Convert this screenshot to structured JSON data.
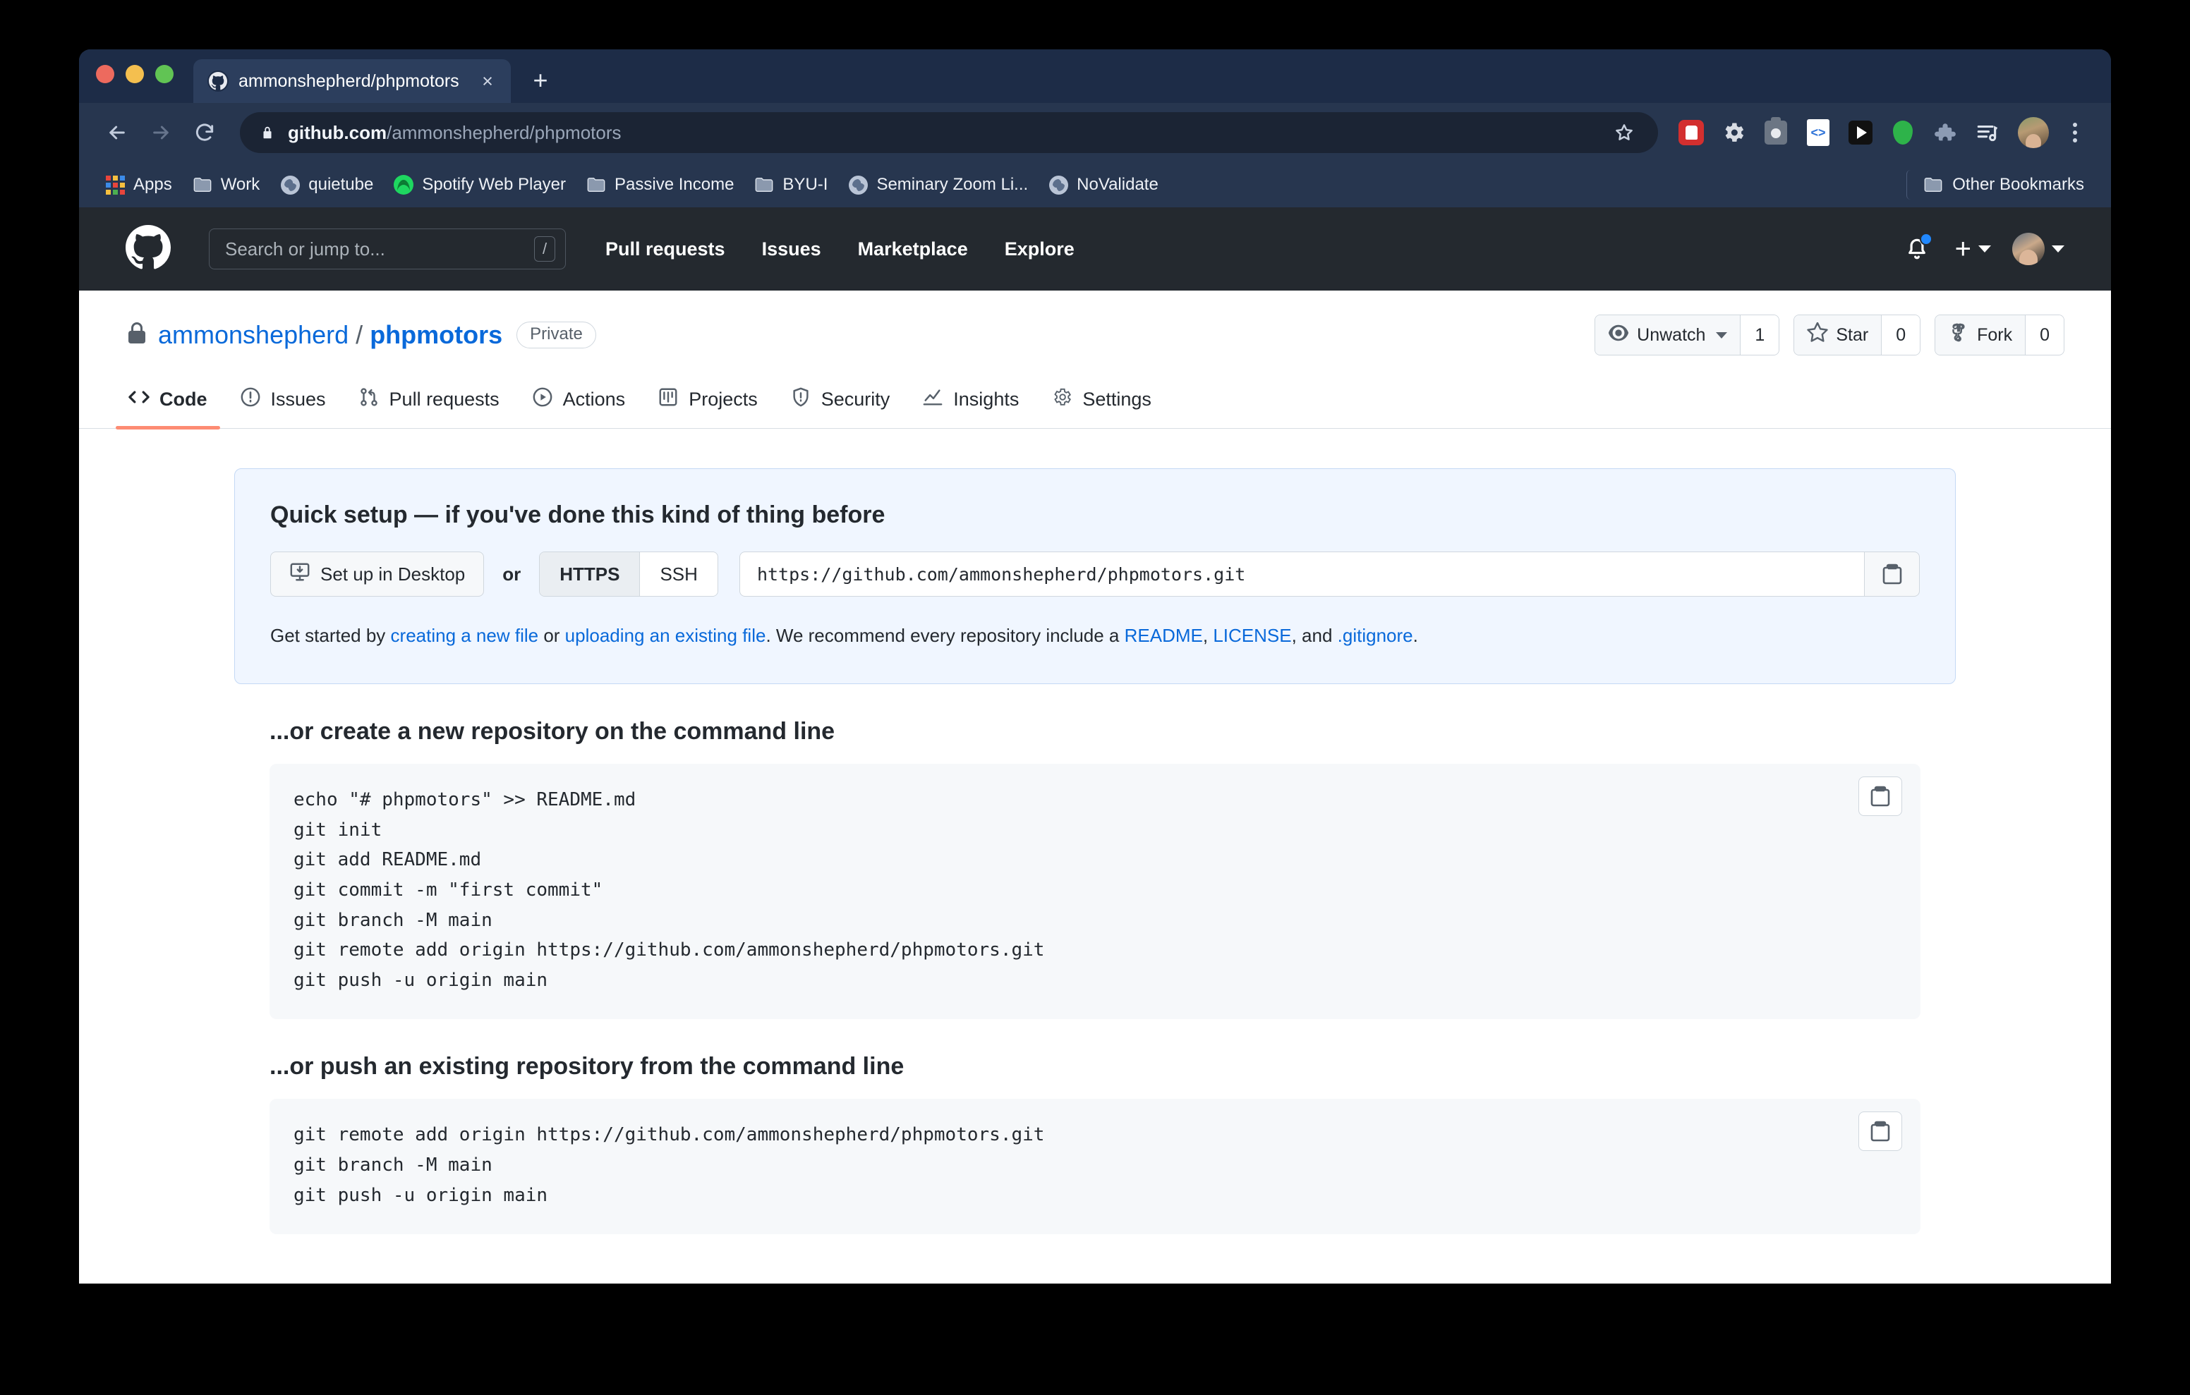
{
  "browser": {
    "tab": {
      "title": "ammonshepherd/phpmotors",
      "favicon": "github-icon",
      "close_label": "×"
    },
    "new_tab_label": "+",
    "omnibox": {
      "host": "github.com",
      "path": "/ammonshepherd/phpmotors",
      "lock": "lock-icon"
    },
    "extensions": [
      {
        "name": "adblock-icon"
      },
      {
        "name": "gear-icon"
      },
      {
        "name": "camera-icon"
      },
      {
        "name": "code-file-icon"
      },
      {
        "name": "play-icon"
      },
      {
        "name": "balloon-icon"
      },
      {
        "name": "puzzle-extensions-icon"
      },
      {
        "name": "music-queue-icon"
      }
    ],
    "bookmarks": [
      {
        "label": "Apps",
        "icon": "apps-grid-icon"
      },
      {
        "label": "Work",
        "icon": "folder-icon"
      },
      {
        "label": "quietube",
        "icon": "globe-icon"
      },
      {
        "label": "Spotify Web Player",
        "icon": "spotify-icon"
      },
      {
        "label": "Passive Income",
        "icon": "folder-icon"
      },
      {
        "label": "BYU-I",
        "icon": "folder-icon"
      },
      {
        "label": "Seminary Zoom Li...",
        "icon": "globe-icon"
      },
      {
        "label": "NoValidate",
        "icon": "globe-icon"
      }
    ],
    "other_bookmarks": {
      "label": "Other Bookmarks",
      "icon": "folder-icon"
    }
  },
  "github": {
    "header": {
      "logo": "github-mark-icon",
      "search_placeholder": "Search or jump to...",
      "search_shortcut": "/",
      "nav": [
        {
          "label": "Pull requests"
        },
        {
          "label": "Issues"
        },
        {
          "label": "Marketplace"
        },
        {
          "label": "Explore"
        }
      ],
      "notifications_icon": "bell-icon",
      "has_unread": true,
      "create_new_label": "+"
    },
    "repo": {
      "visibility_icon": "lock-icon",
      "owner": "ammonshepherd",
      "separator": "/",
      "name": "phpmotors",
      "visibility": "Private",
      "actions": [
        {
          "label": "Unwatch",
          "count": "1",
          "icon": "eye-icon",
          "has_caret": true
        },
        {
          "label": "Star",
          "count": "0",
          "icon": "star-icon",
          "has_caret": false
        },
        {
          "label": "Fork",
          "count": "0",
          "icon": "fork-icon",
          "has_caret": false
        }
      ],
      "tabs": [
        {
          "label": "Code",
          "icon": "code-icon",
          "active": true
        },
        {
          "label": "Issues",
          "icon": "issue-opened-icon",
          "active": false
        },
        {
          "label": "Pull requests",
          "icon": "git-pull-request-icon",
          "active": false
        },
        {
          "label": "Actions",
          "icon": "play-circle-icon",
          "active": false
        },
        {
          "label": "Projects",
          "icon": "project-board-icon",
          "active": false
        },
        {
          "label": "Security",
          "icon": "shield-icon",
          "active": false
        },
        {
          "label": "Insights",
          "icon": "graph-icon",
          "active": false
        },
        {
          "label": "Settings",
          "icon": "gear-icon",
          "active": false
        }
      ]
    },
    "quick_setup": {
      "title": "Quick setup — if you've done this kind of thing before",
      "desktop_button": "Set up in Desktop",
      "or": "or",
      "protocols": [
        {
          "label": "HTTPS",
          "selected": true
        },
        {
          "label": "SSH",
          "selected": false
        }
      ],
      "clone_url": "https://github.com/ammonshepherd/phpmotors.git",
      "copy_icon": "clipboard-icon",
      "get_started": {
        "prefix": "Get started by ",
        "link1": "creating a new file",
        "mid1": " or ",
        "link2": "uploading an existing file",
        "mid2": ". We recommend every repository include a ",
        "link3": "README",
        "mid3": ", ",
        "link4": "LICENSE",
        "mid4": ", and ",
        "link5": ".gitignore",
        "suffix": "."
      }
    },
    "cli_sections": [
      {
        "title": "...or create a new repository on the command line",
        "code": "echo \"# phpmotors\" >> README.md\ngit init\ngit add README.md\ngit commit -m \"first commit\"\ngit branch -M main\ngit remote add origin https://github.com/ammonshepherd/phpmotors.git\ngit push -u origin main",
        "copy_icon": "clipboard-icon"
      },
      {
        "title": "...or push an existing repository from the command line",
        "code": "git remote add origin https://github.com/ammonshepherd/phpmotors.git\ngit branch -M main\ngit push -u origin main",
        "copy_icon": "clipboard-icon"
      }
    ]
  },
  "colors": {
    "accent": "#0969da",
    "active_tab_underline": "#fd8c73",
    "quick_setup_bg": "#f0f6ff",
    "gh_header_bg": "#24292f",
    "browser_chrome": "#27364f"
  }
}
